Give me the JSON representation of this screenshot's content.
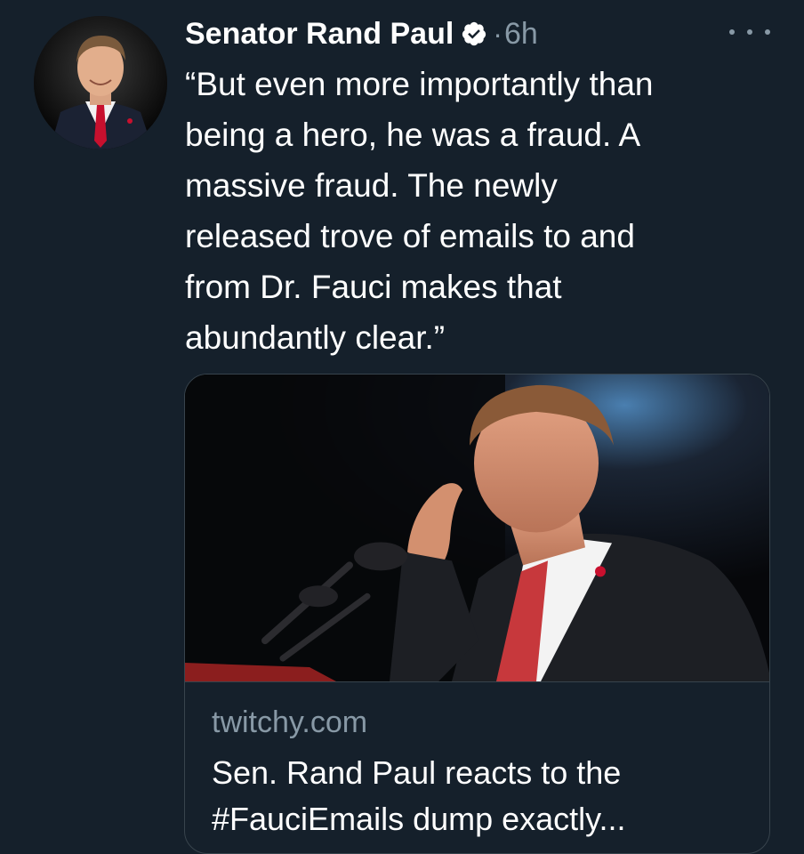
{
  "tweet": {
    "author": {
      "display_name": "Senator Rand Paul",
      "verified": true,
      "avatar_icon": "profile-photo"
    },
    "separator": "·",
    "timestamp": "6h",
    "more_icon": "more-horizontal-icon",
    "text_lines": [
      "“But even more importantly than",
      "being a hero, he was a fraud. A",
      "massive fraud. The newly",
      "released trove of emails to and",
      "from Dr. Fauci makes that",
      "abundantly clear.”"
    ],
    "card": {
      "domain": "twitchy.com",
      "title_lines": [
        "Sen. Rand Paul reacts to the",
        "#FauciEmails dump exactly..."
      ]
    }
  },
  "colors": {
    "background": "#15202b",
    "text_primary": "#ffffff",
    "text_secondary": "#8899a6",
    "border": "#38444d",
    "verified": "#ffffff"
  }
}
